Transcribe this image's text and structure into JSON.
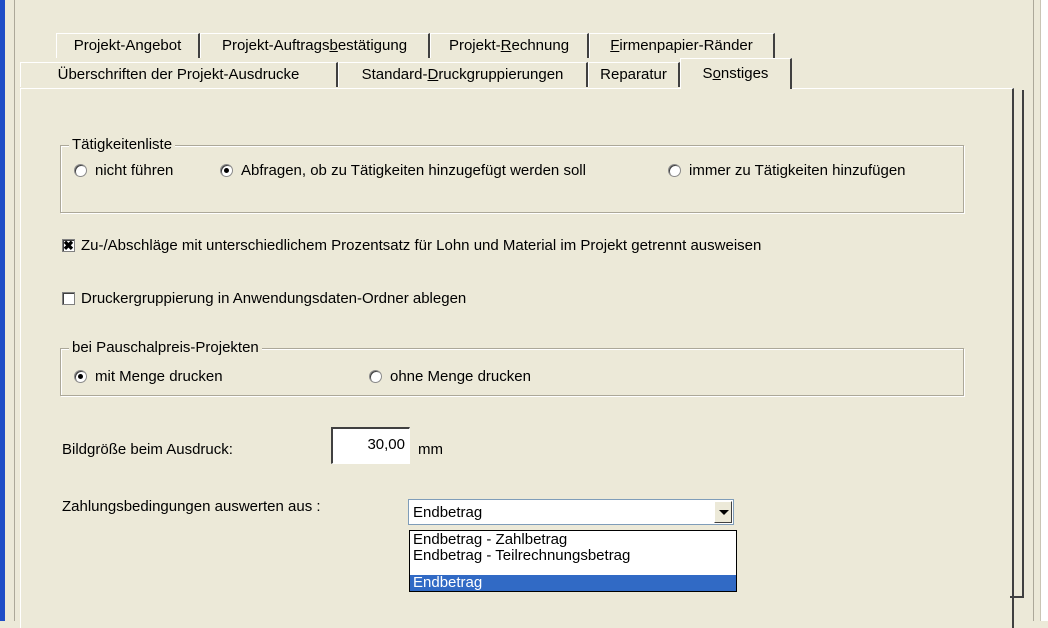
{
  "tabs_back_row": [
    {
      "label": "Projekt-Angebot"
    },
    {
      "label_pre": "Projekt-Auftrags",
      "label_acc": "b",
      "label_post": "estätigung"
    },
    {
      "label_pre": "Projekt-",
      "label_acc": "R",
      "label_post": "echnung"
    },
    {
      "label_pre": "",
      "label_acc": "F",
      "label_post": "irmenpapier-Ränder"
    }
  ],
  "tabs_front_row": [
    {
      "label": "Überschriften der Projekt-Ausdrucke"
    },
    {
      "label_pre": "Standard-",
      "label_acc": "D",
      "label_post": "ruckgruppierungen"
    },
    {
      "label": "Reparatur"
    },
    {
      "label_pre": "S",
      "label_acc": "o",
      "label_post": "nstiges"
    }
  ],
  "taetigkeiten": {
    "legend": "Tätigkeitenliste",
    "options": [
      "nicht führen",
      "Abfragen, ob zu Tätigkeiten hinzugefügt werden soll",
      "immer zu Tätigkeiten hinzufügen"
    ],
    "selected": 1
  },
  "checkbox_zuschlaege": {
    "label": "Zu-/Abschläge mit unterschiedlichem Prozentsatz für Lohn und Material im Projekt getrennt ausweisen",
    "checked": true,
    "mark": "✖"
  },
  "checkbox_druckergruppierung": {
    "label": "Druckergruppierung in Anwendungsdaten-Ordner ablegen",
    "checked": false
  },
  "pauschalpreis": {
    "legend": "bei Pauschalpreis-Projekten",
    "options": [
      "mit Menge drucken",
      "ohne Menge drucken"
    ],
    "selected": 0
  },
  "bildgroesse": {
    "label": "Bildgröße beim Ausdruck:",
    "value": "30,00",
    "unit": "mm"
  },
  "zahlungsbedingungen": {
    "label": "Zahlungsbedingungen auswerten aus :",
    "value": "Endbetrag",
    "options": [
      "Endbetrag - Zahlbetrag",
      "Endbetrag - Teilrechnungsbetrag",
      "Endbetrag"
    ],
    "highlighted": 2
  }
}
